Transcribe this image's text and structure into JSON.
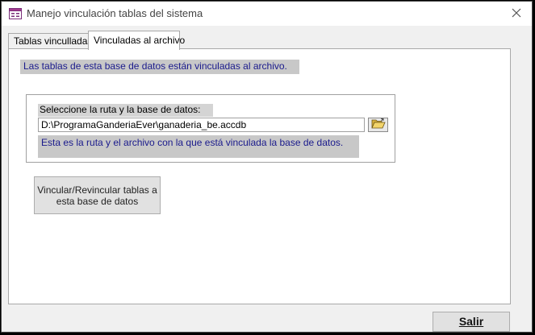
{
  "window": {
    "title": "Manejo vinculación  tablas del sistema",
    "close_symbol": "✕"
  },
  "tabs": [
    {
      "label": "Tablas vinculladas",
      "selected": false
    },
    {
      "label": "Vinculadas al archivo",
      "selected": true
    }
  ],
  "panel": {
    "info_text": "Las tablas de esta base de datos están vinculadas al archivo.",
    "path_group": {
      "caption": "Seleccione la ruta y la base de datos:",
      "path_value": "D:\\ProgramaGanderiaEver\\ganaderia_be.accdb",
      "browse_icon": "folder-open-icon",
      "description": "Esta es la ruta y el archivo con la que está vinculada la base de datos."
    },
    "relink_button_label": "Vincular/Revincular tablas a\nesta base de datos"
  },
  "footer": {
    "exit_button_label": "Salir"
  },
  "colors": {
    "label_background": "#c8c8c8",
    "label_text": "#1a1a8c",
    "panel_background": "#ffffff",
    "window_background": "#f0f0f0"
  }
}
